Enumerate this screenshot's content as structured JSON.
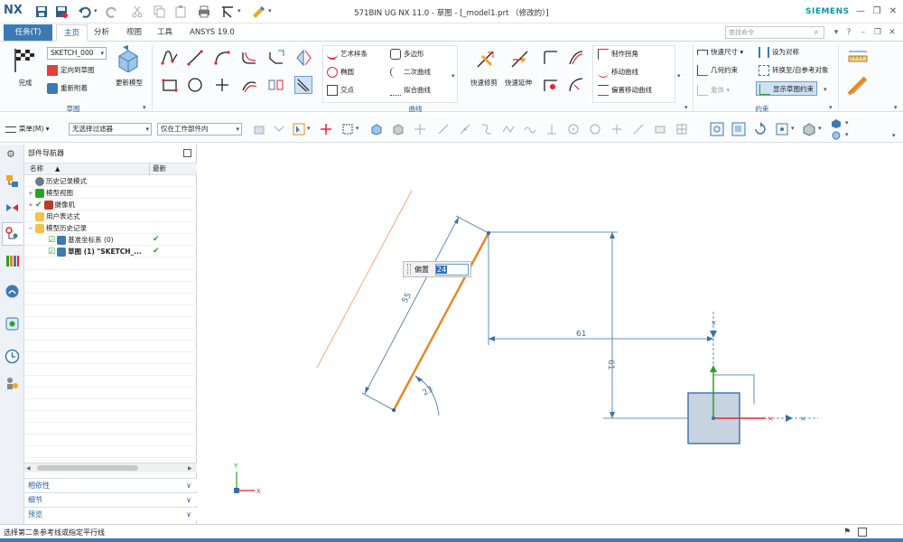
{
  "app": {
    "logo": "NX",
    "title": "571BIN UG NX 11.0 - 草图 - [_model1.prt （修改的）]",
    "brand": "SIEMENS",
    "window_controls": [
      "minimize-icon",
      "restore-icon",
      "close-icon"
    ]
  },
  "menubar": {
    "task_button": "任务(T)",
    "tabs": [
      "主页",
      "分析",
      "视图",
      "工具",
      "ANSYS 19.0"
    ],
    "active_tab": "主页",
    "search_placeholder": "查找命令"
  },
  "ribbon": {
    "sketch_group": {
      "label": "草图",
      "finish_label": "完成",
      "sketch_name": "SKETCH_000",
      "orient_label": "定向到草图",
      "reattach_label": "重新附着",
      "update_label": "更新模型"
    },
    "curve_group": {
      "label": "曲线",
      "items": [
        "艺术样条",
        "多边形",
        "椭圆",
        "二次曲线",
        "交点",
        "拟合曲线"
      ],
      "quick_trim": "快速修剪",
      "quick_extend": "快速延伸",
      "edit_items": [
        "制作拐角",
        "移动曲线",
        "偏置移动曲线"
      ]
    },
    "constraint_group": {
      "label": "约束",
      "items": [
        "快速尺寸",
        "设为对称",
        "几何约束",
        "转换至/自参考对象",
        "显示草图约束"
      ],
      "disabled_item": "重体"
    }
  },
  "toolbar2": {
    "menu_label": "菜单(M)",
    "filter_label": "无选择过滤器",
    "scope_label": "仅在工作部件内"
  },
  "navigator": {
    "title": "部件导航器",
    "col_name": "名称",
    "col_latest": "最新",
    "tree": [
      {
        "label": "历史记录模式",
        "level": 0,
        "exp": "",
        "icon": "clock-icon",
        "latest": ""
      },
      {
        "label": "模型视图",
        "level": 0,
        "exp": "+",
        "icon": "model-views-icon",
        "latest": ""
      },
      {
        "label": "摄像机",
        "level": 0,
        "exp": "+",
        "icon": "camera-icon",
        "latest": "",
        "check": "✔"
      },
      {
        "label": "用户表达式",
        "level": 0,
        "exp": "",
        "icon": "folder-icon",
        "latest": ""
      },
      {
        "label": "模型历史记录",
        "level": 0,
        "exp": "−",
        "icon": "folder-icon",
        "latest": ""
      },
      {
        "label": "基准坐标系 (0)",
        "level": 1,
        "exp": "",
        "icon": "datum-csys-icon",
        "latest": "✔",
        "check": "☑"
      },
      {
        "label": "草图 (1) \"SKETCH_...",
        "level": 1,
        "exp": "",
        "icon": "sketch-icon",
        "latest": "✔",
        "check": "☑"
      }
    ],
    "accordions": [
      "相依性",
      "细节",
      "预览"
    ]
  },
  "canvas": {
    "offset_label": "偏置",
    "offset_value": "24",
    "dimensions": [
      "55",
      "61",
      "61",
      "23"
    ]
  },
  "status": {
    "message": "选择第二条参考线或指定平行线"
  },
  "colors": {
    "accent": "#3c7ab5",
    "brand": "#0a9b9b",
    "sketch_line": "#e8861e",
    "dimension": "#3b6fa8"
  }
}
